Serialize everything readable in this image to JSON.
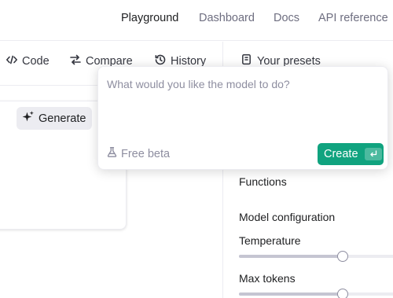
{
  "nav": {
    "items": [
      {
        "label": "Playground",
        "active": true
      },
      {
        "label": "Dashboard",
        "active": false
      },
      {
        "label": "Docs",
        "active": false
      },
      {
        "label": "API reference",
        "active": false
      }
    ]
  },
  "toolbar": {
    "code_label": "Code",
    "compare_label": "Compare",
    "history_label": "History"
  },
  "generate_label": "Generate",
  "presets_label": "Your presets",
  "right_panel": {
    "functions_label": "Functions",
    "model_config_label": "Model configuration",
    "temperature_label": "Temperature",
    "temperature_value_fraction": 0.66,
    "max_tokens_label": "Max tokens",
    "max_tokens_value_fraction": 0.66
  },
  "popover": {
    "placeholder": "What would you like the model to do?",
    "free_beta_label": "Free beta",
    "create_label": "Create"
  },
  "colors": {
    "accent": "#10a37f",
    "muted_text": "#8e8ea0"
  }
}
